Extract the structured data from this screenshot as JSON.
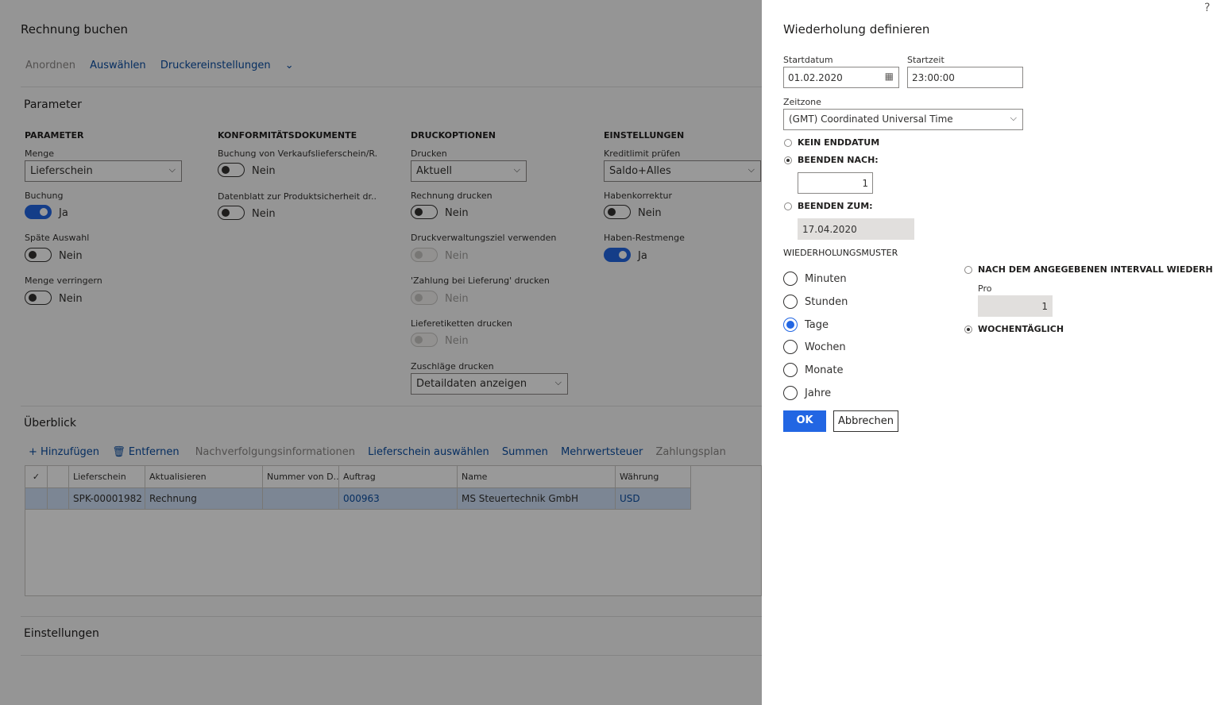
{
  "page": {
    "title": "Rechnung buchen",
    "actions": [
      "Anordnen",
      "Auswählen",
      "Druckereinstellungen"
    ],
    "parameters_section": "Parameter",
    "columns": {
      "parameter": {
        "header": "PARAMETER",
        "menge_label": "Menge",
        "menge_value": "Lieferschein",
        "buchung_label": "Buchung",
        "buchung_value": "Ja",
        "spaete_label": "Späte Auswahl",
        "spaete_value": "Nein",
        "verringern_label": "Menge verringern",
        "verringern_value": "Nein"
      },
      "konformitaet": {
        "header": "KONFORMITÄTSDOKUMENTE",
        "buchung_label": "Buchung von Verkaufslieferschein/R...",
        "buchung_value": "Nein",
        "datenblatt_label": "Datenblatt zur Produktsicherheit dr...",
        "datenblatt_value": "Nein"
      },
      "druck": {
        "header": "DRUCKOPTIONEN",
        "drucken_label": "Drucken",
        "drucken_value": "Aktuell",
        "rechnung_label": "Rechnung drucken",
        "rechnung_value": "Nein",
        "ziel_label": "Druckverwaltungsziel verwenden",
        "ziel_value": "Nein",
        "zahlung_label": "'Zahlung bei Lieferung' drucken",
        "zahlung_value": "Nein",
        "etiketten_label": "Lieferetiketten drucken",
        "etiketten_value": "Nein",
        "zuschlaege_label": "Zuschläge drucken",
        "zuschlaege_value": "Detaildaten anzeigen"
      },
      "einstellungen": {
        "header": "EINSTELLUNGEN",
        "kredit_label": "Kreditlimit prüfen",
        "kredit_value": "Saldo+Alles",
        "haben_label": "Habenkorrektur",
        "haben_value": "Nein",
        "rest_label": "Haben-Restmenge",
        "rest_value": "Ja"
      }
    },
    "overview": {
      "title": "Überblick",
      "toolbar": {
        "add": "Hinzufügen",
        "remove": "Entfernen",
        "tracking": "Nachverfolgungsinformationen",
        "select_slip": "Lieferschein auswählen",
        "sums": "Summen",
        "vat": "Mehrwertsteuer",
        "payment_plan": "Zahlungsplan"
      },
      "headers": [
        "Lieferschein",
        "Aktualisieren",
        "Nummer von D...",
        "Auftrag",
        "Name",
        "Währung"
      ],
      "rows": [
        {
          "lieferschein": "SPK-00001982",
          "aktualisieren": "Rechnung",
          "nummer": "",
          "auftrag": "000963",
          "name": "MS Steuertechnik GmbH",
          "waehrung": "USD"
        }
      ]
    },
    "einstellungen_section": "Einstellungen"
  },
  "panel": {
    "help": "?",
    "title": "Wiederholung definieren",
    "startdatum_label": "Startdatum",
    "startdatum_value": "01.02.2020",
    "startzeit_label": "Startzeit",
    "startzeit_value": "23:00:00",
    "zeitzone_label": "Zeitzone",
    "zeitzone_value": "(GMT) Coordinated Universal Time",
    "kein_enddatum": "KEIN ENDDATUM",
    "beenden_nach": "BEENDEN NACH:",
    "beenden_nach_value": "1",
    "beenden_zum": "BEENDEN ZUM:",
    "beenden_zum_value": "17.04.2020",
    "pattern_title": "WIEDERHOLUNGSMUSTER",
    "patterns": [
      "Minuten",
      "Stunden",
      "Tage",
      "Wochen",
      "Monate",
      "Jahre"
    ],
    "selected_pattern": "Tage",
    "interval_label": "NACH DEM ANGEGEBENEN INTERVALL WIEDERHOLEN",
    "pro_label": "Pro",
    "pro_value": "1",
    "weekday_label": "WOCHENTÄGLICH",
    "ok": "OK",
    "cancel": "Abbrechen"
  },
  "colors": {
    "accent": "#2266e3",
    "link": "#0b4ea2",
    "selected_row": "#cfe0f7"
  }
}
